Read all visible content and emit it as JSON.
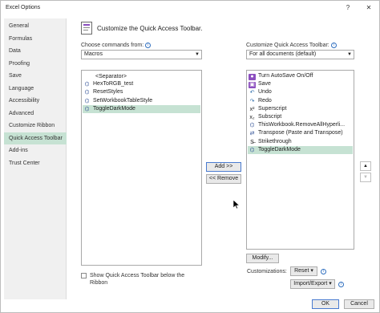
{
  "window": {
    "title": "Excel Options",
    "help": "?",
    "close": "✕"
  },
  "sidebar": {
    "items": [
      {
        "label": "General"
      },
      {
        "label": "Formulas"
      },
      {
        "label": "Data"
      },
      {
        "label": "Proofing"
      },
      {
        "label": "Save"
      },
      {
        "label": "Language"
      },
      {
        "label": "Accessibility"
      },
      {
        "label": "Advanced"
      },
      {
        "label": "Customize Ribbon"
      },
      {
        "label": "Quick Access Toolbar",
        "selected": true
      },
      {
        "label": "Add-ins"
      },
      {
        "label": "Trust Center"
      }
    ]
  },
  "main": {
    "heading": "Customize the Quick Access Toolbar.",
    "choose_label": "Choose commands from:",
    "choose_value": "Macros",
    "customize_label": "Customize Quick Access Toolbar:",
    "customize_value": "For all documents (default)",
    "left_list": [
      {
        "label": "<Separator>",
        "icon": ""
      },
      {
        "label": "HexToRGB_test",
        "icon": "macro-icon"
      },
      {
        "label": "ResetStyles",
        "icon": "macro-icon"
      },
      {
        "label": "SetWorkbookTableStyle",
        "icon": "macro-icon"
      },
      {
        "label": "ToggleDarkMode",
        "icon": "macro-icon",
        "selected": true
      }
    ],
    "right_list": [
      {
        "label": "Turn AutoSave On/Off",
        "icon": "autosave-icon"
      },
      {
        "label": "Save",
        "icon": "save-icon"
      },
      {
        "label": "Undo",
        "icon": "undo-icon"
      },
      {
        "label": "Redo",
        "icon": "redo-icon"
      },
      {
        "label": "Superscript",
        "icon": "superscript-icon"
      },
      {
        "label": "Subscript",
        "icon": "subscript-icon"
      },
      {
        "label": "ThisWorkbook.RemoveAllHyperli...",
        "icon": "macro-icon"
      },
      {
        "label": "Transpose (Paste and Transpose)",
        "icon": "transpose-icon"
      },
      {
        "label": "Strikethrough",
        "icon": "strikethrough-icon"
      },
      {
        "label": "ToggleDarkMode",
        "icon": "macro-icon",
        "selected": true
      }
    ],
    "add_button": "Add >>",
    "remove_button": "<< Remove",
    "modify_button": "Modify...",
    "customizations_label": "Customizations:",
    "reset_button": "Reset",
    "import_export_button": "Import/Export",
    "show_below_ribbon": "Show Quick Access Toolbar below the Ribbon",
    "show_below_checked": false
  },
  "footer": {
    "ok": "OK",
    "cancel": "Cancel"
  }
}
